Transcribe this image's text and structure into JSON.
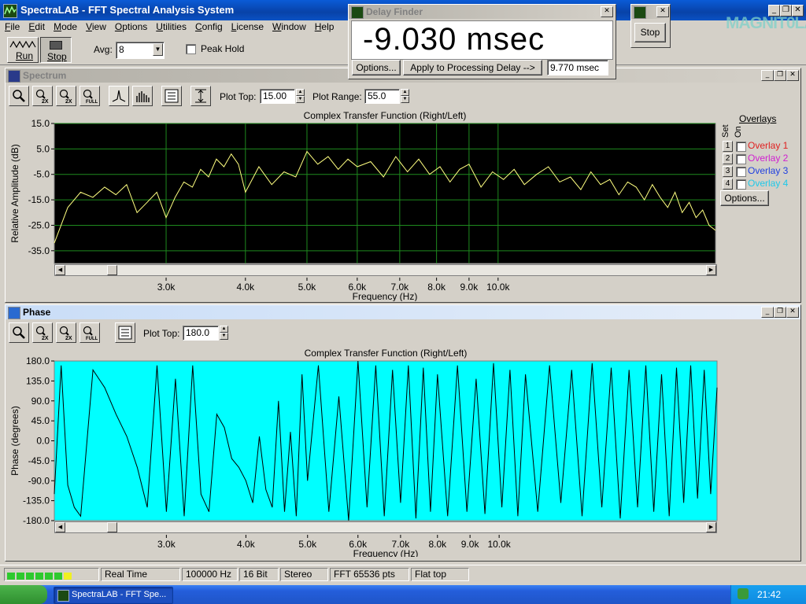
{
  "app": {
    "title": "SpectraLAB - FFT Spectral Analysis System",
    "watermark": "MAGNIT0LA"
  },
  "menu": [
    "File",
    "Edit",
    "Mode",
    "View",
    "Options",
    "Utilities",
    "Config",
    "License",
    "Window",
    "Help"
  ],
  "toolbar": {
    "run_label": "Run",
    "stop_label": "Stop",
    "avg_label": "Avg:",
    "avg_value": "8",
    "peak_hold_label": "Peak Hold"
  },
  "delay_finder": {
    "title": "Delay Finder",
    "readout": "-9.030 msec",
    "options_label": "Options...",
    "apply_label": "Apply to Processing Delay -->",
    "processing_delay": "9.770 msec"
  },
  "stop_window": {
    "stop_label": "Stop"
  },
  "spectrum": {
    "title": "Spectrum",
    "zoom_in_label": "IN 2X",
    "zoom_out_label": "OUT 2X",
    "zoom_full_label": "OUT FULL",
    "plot_top_label": "Plot Top:",
    "plot_top_value": "15.00",
    "plot_range_label": "Plot Range:",
    "plot_range_value": "55.0",
    "overlays": {
      "title": "Overlays",
      "set_label": "Set",
      "on_label": "On",
      "items": [
        {
          "num": "1",
          "name": "Overlay 1",
          "color": "#e02020"
        },
        {
          "num": "2",
          "name": "Overlay 2",
          "color": "#d020d0"
        },
        {
          "num": "3",
          "name": "Overlay 3",
          "color": "#2040e0"
        },
        {
          "num": "4",
          "name": "Overlay 4",
          "color": "#20c8e8"
        }
      ],
      "options_label": "Options..."
    }
  },
  "phase": {
    "title": "Phase",
    "plot_top_label": "Plot Top:",
    "plot_top_value": "180.0"
  },
  "status": {
    "mode": "Real Time",
    "sample_rate": "100000 Hz",
    "bits": "16 Bit",
    "channels": "Stereo",
    "fft": "FFT 65536 pts",
    "window": "Flat top"
  },
  "taskbar": {
    "task_label": "SpectraLAB - FFT Spe...",
    "lang": "EN",
    "clock": "21:42"
  },
  "chart_data": [
    {
      "type": "line",
      "title": "Complex Transfer Function (Right/Left)",
      "xlabel": "Frequency (Hz)",
      "ylabel": "Relative Amplitude (dB)",
      "xscale": "log",
      "xlim": [
        2000,
        22000
      ],
      "ylim": [
        -40,
        15
      ],
      "yticks": [
        "15.0",
        "5.0",
        "-5.0",
        "-15.0",
        "-25.0",
        "-35.0"
      ],
      "xticks": [
        "3.0k",
        "4.0k",
        "5.0k",
        "6.0k",
        "7.0k",
        "8.0k",
        "9.0k",
        "10.0k"
      ],
      "grid": true,
      "background": "#000000",
      "grid_color": "#1e8a1e",
      "line_color": "#ffff80",
      "series": [
        {
          "x": [
            2000,
            2100,
            2200,
            2300,
            2400,
            2500,
            2600,
            2700,
            2800,
            2900,
            3000,
            3100,
            3200,
            3300,
            3400,
            3500,
            3600,
            3700,
            3800,
            3900,
            4000,
            4200,
            4400,
            4600,
            4800,
            5000,
            5200,
            5400,
            5600,
            5800,
            6000,
            6300,
            6600,
            6900,
            7200,
            7500,
            7800,
            8100,
            8400,
            8700,
            9000,
            9400,
            9800,
            10200,
            10600,
            11000,
            11500,
            12000,
            12500,
            13000,
            13500,
            14000,
            14500,
            15000,
            15500,
            16000,
            16500,
            17000,
            17500,
            18000,
            18500,
            19000,
            19500,
            20000,
            20500,
            21000,
            21500,
            22000
          ],
          "y": [
            -32,
            -18,
            -12,
            -14,
            -10,
            -13,
            -9,
            -20,
            -16,
            -12,
            -22,
            -14,
            -8,
            -10,
            -3,
            -6,
            1,
            -2,
            3,
            -1,
            -12,
            -2,
            -9,
            -4,
            -6,
            4,
            -1,
            2,
            -3,
            1,
            -2,
            0,
            -6,
            2,
            -4,
            1,
            -5,
            -2,
            -8,
            -3,
            -1,
            -10,
            -4,
            -7,
            -3,
            -9,
            -5,
            -2,
            -8,
            -6,
            -11,
            -4,
            -9,
            -7,
            -13,
            -8,
            -10,
            -15,
            -9,
            -14,
            -18,
            -12,
            -20,
            -16,
            -22,
            -19,
            -25,
            -27
          ]
        }
      ]
    },
    {
      "type": "line",
      "title": "Complex Transfer Function (Right/Left)",
      "xlabel": "Frequency (Hz)",
      "ylabel": "Phase (degrees)",
      "xscale": "log",
      "xlim": [
        2000,
        22000
      ],
      "ylim": [
        -180,
        180
      ],
      "yticks": [
        "180.0",
        "135.0",
        "90.0",
        "45.0",
        "0.0",
        "-45.0",
        "-90.0",
        "-135.0",
        "-180.0"
      ],
      "xticks": [
        "3.0k",
        "4.0k",
        "5.0k",
        "6.0k",
        "7.0k",
        "8.0k",
        "9.0k",
        "10.0k"
      ],
      "grid": false,
      "background": "#00ffff",
      "line_color": "#000000",
      "series": [
        {
          "x": [
            2000,
            2050,
            2100,
            2150,
            2200,
            2300,
            2400,
            2500,
            2600,
            2700,
            2800,
            2900,
            3000,
            3100,
            3200,
            3300,
            3400,
            3500,
            3600,
            3700,
            3800,
            3900,
            4000,
            4100,
            4200,
            4300,
            4400,
            4500,
            4600,
            4700,
            4800,
            4900,
            5000,
            5200,
            5400,
            5600,
            5800,
            6000,
            6200,
            6400,
            6600,
            6800,
            7000,
            7200,
            7400,
            7600,
            7800,
            8000,
            8300,
            8600,
            8900,
            9200,
            9500,
            9800,
            10100,
            10400,
            10700,
            11000,
            11500,
            12000,
            12500,
            13000,
            13500,
            14000,
            14500,
            15000,
            15500,
            16000,
            16500,
            17000,
            17500,
            18000,
            18500,
            19000,
            19500,
            20000,
            20500,
            21000,
            21500,
            22000
          ],
          "y": [
            -120,
            170,
            -100,
            -150,
            -170,
            160,
            120,
            60,
            10,
            -60,
            -150,
            170,
            -160,
            140,
            -170,
            170,
            -120,
            -160,
            60,
            30,
            -40,
            -60,
            -90,
            -140,
            10,
            -110,
            -150,
            90,
            -160,
            20,
            -170,
            150,
            -90,
            170,
            -160,
            100,
            -180,
            180,
            -150,
            170,
            -170,
            160,
            -140,
            170,
            -175,
            165,
            -160,
            150,
            -170,
            170,
            -160,
            140,
            -165,
            175,
            -150,
            160,
            -170,
            150,
            -160,
            170,
            -140,
            160,
            -170,
            175,
            -150,
            165,
            -175,
            160,
            -150,
            170,
            -160,
            150,
            -170,
            165,
            -140,
            170,
            -130,
            160,
            -120,
            120
          ]
        }
      ]
    }
  ]
}
